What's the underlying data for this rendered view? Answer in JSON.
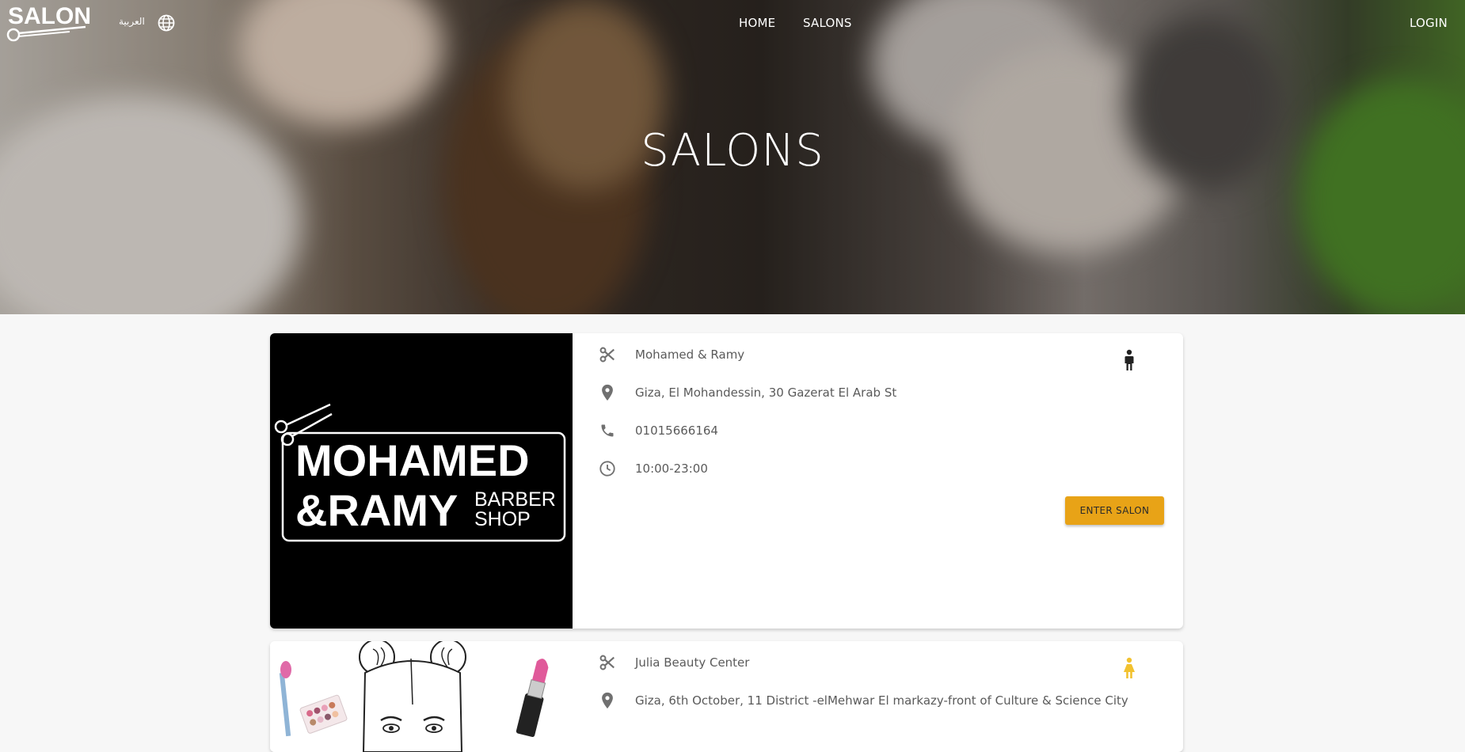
{
  "nav": {
    "logo_text": "SALON",
    "language_label": "العربية",
    "links": {
      "home": "HOME",
      "salons": "SALONS"
    },
    "login": "LOGIN"
  },
  "hero": {
    "title": "SALONS"
  },
  "salons": [
    {
      "name": "Mohamed & Ramy",
      "address": "Giza, El Mohandessin, 30 Gazerat El Arab St",
      "phone": "01015666164",
      "hours": "10:00-23:00",
      "gender": "male",
      "gender_color": "#222222",
      "enter_label": "ENTER SALON",
      "logo": {
        "line1": "MOHAMED",
        "line2": "&RAMY",
        "line3a": "BARBER",
        "line3b": "SHOP"
      }
    },
    {
      "name": "Julia Beauty Center",
      "address": "Giza, 6th October, 11 District -elMehwar El markazy-front of Culture & Science City",
      "gender": "female",
      "gender_color": "#f2c230"
    }
  ],
  "colors": {
    "accent": "#e8a317",
    "icon": "#707070"
  }
}
